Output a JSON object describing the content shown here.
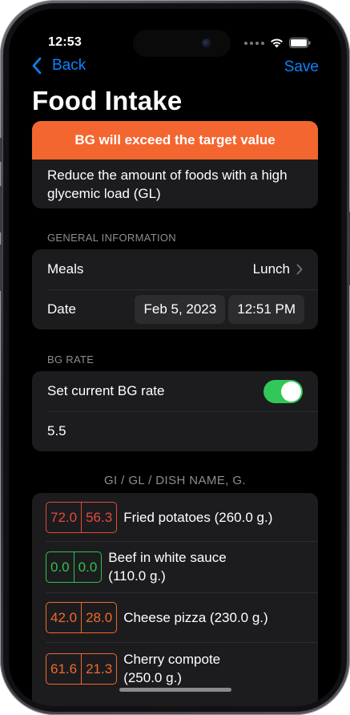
{
  "status_bar": {
    "time": "12:53"
  },
  "nav": {
    "back_label": "Back",
    "save_label": "Save",
    "title": "Food Intake"
  },
  "alert": {
    "header": "BG will exceed the target value",
    "message": "Reduce the amount of foods with a high glycemic load (GL)",
    "header_color": "#f4662f"
  },
  "general_info": {
    "section_label": "GENERAL INFORMATION",
    "meals_label": "Meals",
    "meals_value": "Lunch",
    "date_label": "Date",
    "date_value": "Feb 5, 2023",
    "time_value": "12:51 PM"
  },
  "bg_rate": {
    "section_label": "BG RATE",
    "toggle_label": "Set current BG rate",
    "toggle_on": true,
    "value": "5.5"
  },
  "foods": {
    "header": "GI / GL / DISH NAME, G.",
    "items": [
      {
        "gi": "72.0",
        "gl": "56.3",
        "name": "Fried potatoes (260.0 g.)",
        "color": "red"
      },
      {
        "gi": "0.0",
        "gl": "0.0",
        "name": "Beef in white sauce (110.0 g.)",
        "color": "green"
      },
      {
        "gi": "42.0",
        "gl": "28.0",
        "name": "Cheese pizza (230.0 g.)",
        "color": "orange"
      },
      {
        "gi": "61.6",
        "gl": "21.3",
        "name": "Cherry compote (250.0 g.)",
        "color": "orange"
      }
    ]
  },
  "colors": {
    "accent": "#0a84ff",
    "toggle_on": "#32c759",
    "red": "#e24a3c",
    "green": "#2fc14f",
    "orange": "#ef6a2c"
  }
}
